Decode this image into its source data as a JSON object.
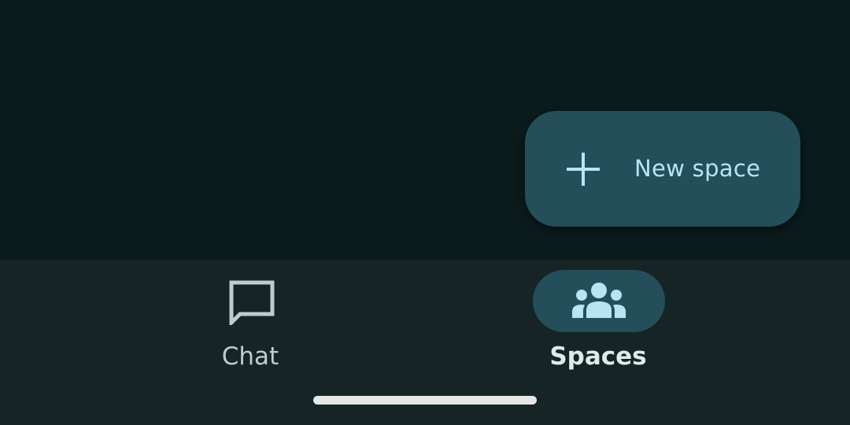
{
  "fab": {
    "label": "New space",
    "icon": "plus-icon"
  },
  "bottom_nav": {
    "items": [
      {
        "label": "Chat",
        "icon": "chat-bubble-icon",
        "selected": false
      },
      {
        "label": "Spaces",
        "icon": "group-icon",
        "selected": true
      }
    ]
  },
  "colors": {
    "background": "#0b1a1b",
    "nav_background": "#172425",
    "accent_container": "#234e5a",
    "accent_on_container": "#b8e4f2"
  }
}
